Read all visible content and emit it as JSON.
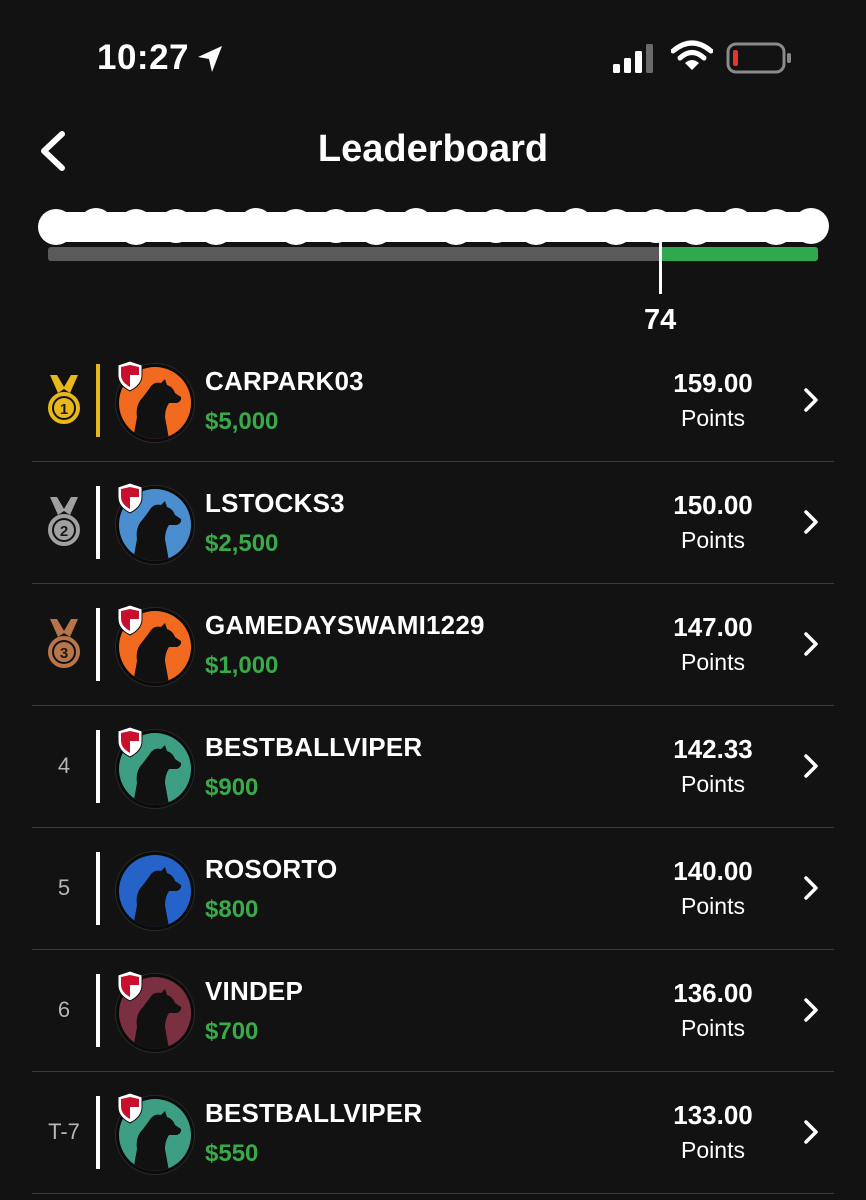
{
  "status_bar": {
    "time": "10:27"
  },
  "header": {
    "title": "Leaderboard"
  },
  "progress": {
    "value": "74",
    "fill_fraction": 0.795
  },
  "score_label": "Points",
  "colors": {
    "accent_green": "#39a94a",
    "gold": "#e8b81a",
    "silver": "#a0a0a0",
    "bronze": "#b8744a"
  },
  "rows": [
    {
      "rank": "1",
      "rank_type": "gold-medal-icon",
      "username": "CARPARK03",
      "prize": "$5,000",
      "score": "159.00",
      "shield": true,
      "avatar_color": "#f26a1f",
      "avatar_icon": "dog-silhouette-icon"
    },
    {
      "rank": "2",
      "rank_type": "silver-medal-icon",
      "username": "LSTOCKS3",
      "prize": "$2,500",
      "score": "150.00",
      "shield": true,
      "avatar_color": "#4a8ed0",
      "avatar_icon": "dog-silhouette-icon"
    },
    {
      "rank": "3",
      "rank_type": "bronze-medal-icon",
      "username": "GAMEDAYSWAMI1229",
      "prize": "$1,000",
      "score": "147.00",
      "shield": true,
      "avatar_color": "#f26a1f",
      "avatar_icon": "dog-silhouette-icon"
    },
    {
      "rank": "4",
      "rank_type": "number",
      "username": "BESTBALLVIPER",
      "prize": "$900",
      "score": "142.33",
      "shield": true,
      "avatar_color": "#3e9e84",
      "avatar_icon": "dog-silhouette-icon"
    },
    {
      "rank": "5",
      "rank_type": "number",
      "username": "ROSORTO",
      "prize": "$800",
      "score": "140.00",
      "shield": false,
      "avatar_color": "#2563c9",
      "avatar_icon": "dog-silhouette-icon"
    },
    {
      "rank": "6",
      "rank_type": "number",
      "username": "VINDEP",
      "prize": "$700",
      "score": "136.00",
      "shield": true,
      "avatar_color": "#7a3040",
      "avatar_icon": "dog-silhouette-icon"
    },
    {
      "rank": "T-7",
      "rank_type": "number",
      "username": "BESTBALLVIPER",
      "prize": "$550",
      "score": "133.00",
      "shield": true,
      "avatar_color": "#3e9e84",
      "avatar_icon": "dog-silhouette-icon"
    }
  ]
}
